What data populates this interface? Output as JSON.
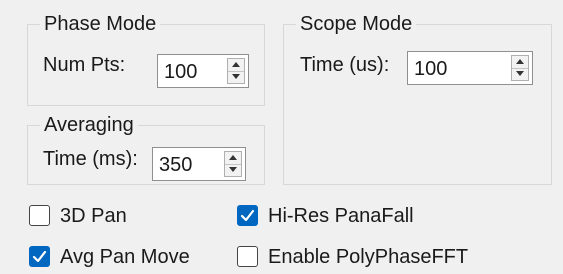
{
  "colors": {
    "window_bg": "#f0f0f0",
    "checkbox_checked": "#0067c0",
    "group_border": "#d8d8d8"
  },
  "phase_mode": {
    "title": "Phase Mode",
    "num_pts_label": "Num Pts:",
    "num_pts_value": "100"
  },
  "averaging": {
    "title": "Averaging",
    "time_label": "Time (ms):",
    "time_value": "350"
  },
  "scope_mode": {
    "title": "Scope Mode",
    "time_label": "Time (us):",
    "time_value": "100"
  },
  "checkboxes": {
    "pan_3d": {
      "label": "3D Pan",
      "checked": false
    },
    "hires_panafall": {
      "label": "Hi-Res PanaFall",
      "checked": true
    },
    "avg_pan_move": {
      "label": "Avg Pan Move",
      "checked": true
    },
    "enable_polyphase_fft": {
      "label": "Enable PolyPhaseFFT",
      "checked": false
    }
  },
  "icons": {
    "spin_up": "triangle-up",
    "spin_down": "triangle-down",
    "check": "checkmark"
  }
}
